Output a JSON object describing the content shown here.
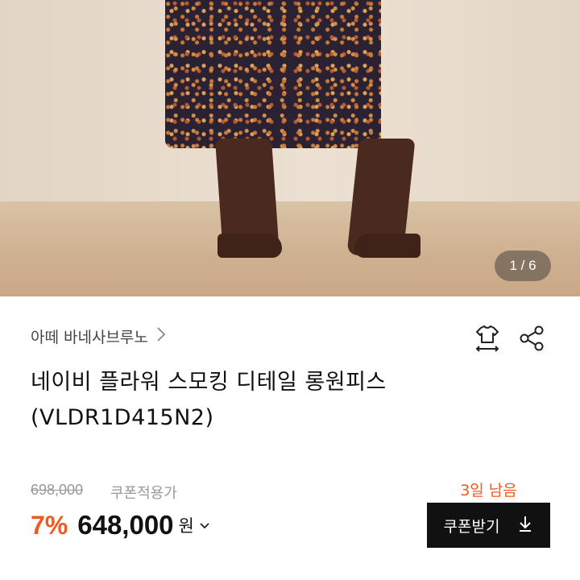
{
  "gallery": {
    "pager": "1 / 6"
  },
  "product": {
    "brand": "아떼 바네사브루노",
    "title_line1": "네이비 플라워 스모킹 디테일 롱원피스",
    "title_line2": "(VLDR1D415N2)",
    "original_price": "698,000",
    "coupon_note": "쿠폰적용가",
    "discount": "7%",
    "price": "648,000",
    "currency": "원"
  },
  "coupon": {
    "days_left": "3일 남음",
    "button_label": "쿠폰받기"
  },
  "icons": {
    "brand_chevron": "chevron-right-icon",
    "size": "size-guide-icon",
    "share": "share-icon",
    "price_chevron": "chevron-down-icon",
    "download": "download-icon"
  },
  "colors": {
    "accent": "#f05a1e",
    "button_bg": "#111111"
  }
}
